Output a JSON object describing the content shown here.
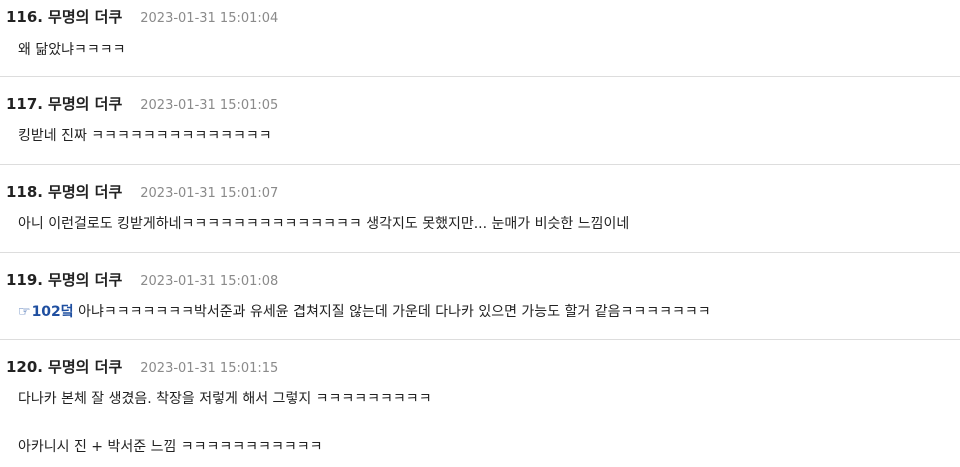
{
  "comments": [
    {
      "number": "116.",
      "author": "무명의 더쿠",
      "timestamp": "2023-01-31 15:01:04",
      "text": "왜 닮았냐ㅋㅋㅋㅋ"
    },
    {
      "number": "117.",
      "author": "무명의 더쿠",
      "timestamp": "2023-01-31 15:01:05",
      "text": "킹받네 진짜 ㅋㅋㅋㅋㅋㅋㅋㅋㅋㅋㅋㅋㅋㅋ"
    },
    {
      "number": "118.",
      "author": "무명의 더쿠",
      "timestamp": "2023-01-31 15:01:07",
      "text": "아니 이런걸로도 킹받게하네ㅋㅋㅋㅋㅋㅋㅋㅋㅋㅋㅋㅋㅋㅋ 생각지도 못했지만... 눈매가 비슷한 느낌이네"
    },
    {
      "number": "119.",
      "author": "무명의 더쿠",
      "timestamp": "2023-01-31 15:01:08",
      "reply_icon": "pointing-hand-icon",
      "reply_glyph": "☞",
      "reply_link": "102덬",
      "text": " 아냐ㅋㅋㅋㅋㅋㅋㅋ박서준과 유세윤 겹쳐지질 않는데 가운데 다나카 있으면 가능도 할거 같음ㅋㅋㅋㅋㅋㅋㅋ"
    },
    {
      "number": "120.",
      "author": "무명의 더쿠",
      "timestamp": "2023-01-31 15:01:15",
      "text": "다나카 본체 잘 생겼음. 착장을 저렇게 해서 그렇지 ㅋㅋㅋㅋㅋㅋㅋㅋㅋ",
      "text2": "아카니시 진 + 박서준 느낌 ㅋㅋㅋㅋㅋㅋㅋㅋㅋㅋㅋ"
    }
  ],
  "colors": {
    "link": "#1f4fa0",
    "timestamp": "#8a8a8a",
    "divider": "#dddddd"
  }
}
